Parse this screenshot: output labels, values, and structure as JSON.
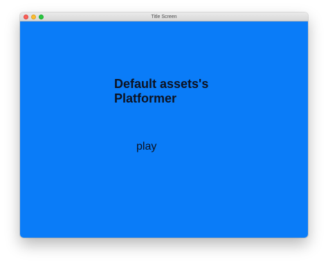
{
  "window": {
    "title": "Title Screen"
  },
  "game": {
    "title_line1": "Default assets's",
    "title_line2": "Platformer",
    "play_label": "play",
    "background_color": "#0a7cf8"
  },
  "icons": {
    "close": "close-icon",
    "minimize": "minimize-icon",
    "zoom": "zoom-icon"
  }
}
